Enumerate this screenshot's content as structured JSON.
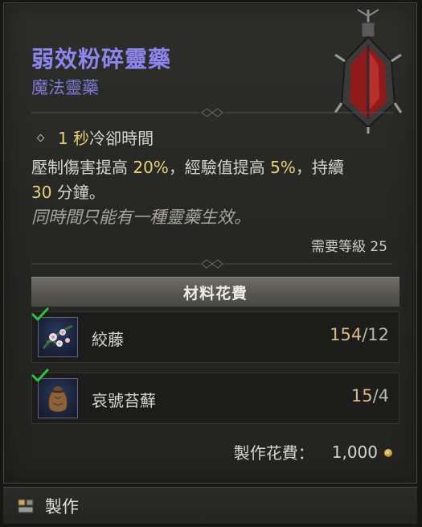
{
  "item": {
    "name": "弱效粉碎靈藥",
    "type": "魔法靈藥",
    "icon": "elixir-flask-icon"
  },
  "effects": {
    "cooldown_value": "1 秒",
    "cooldown_label": "冷卻時間",
    "desc_part1": "壓制傷害提高 ",
    "damage_pct": "20%",
    "desc_part2": "，經驗值提高 ",
    "xp_pct": "5%",
    "desc_part3": "，持續",
    "duration_value": "30",
    "desc_part4": " 分鐘。",
    "note": "同時間只能有一種靈藥生效。",
    "required_level_label": "需要等級",
    "required_level": "25"
  },
  "materials": {
    "header": "材料花費",
    "items": [
      {
        "name": "絞藤",
        "have": "154",
        "need": "/12",
        "icon": "gallowvine-flower-icon",
        "checked": true
      },
      {
        "name": "哀號苔蘚",
        "have": "15",
        "need": "/4",
        "icon": "howler-moss-pouch-icon",
        "checked": true
      }
    ]
  },
  "cost": {
    "label": "製作花費：",
    "value": "1,000",
    "icon": "gold-coin-icon"
  },
  "footer": {
    "craft_label": "製作",
    "craft_icon": "craft-key-icon"
  },
  "colors": {
    "title": "#8c86ee",
    "subtitle": "#7e79d4",
    "highlight": "#e6d277",
    "check": "#2fc23a"
  }
}
